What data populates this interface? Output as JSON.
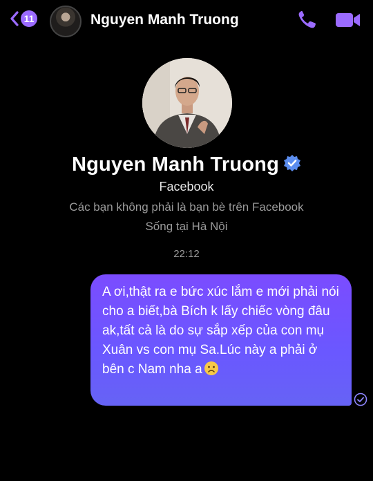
{
  "header": {
    "back_badge": "11",
    "contact_name": "Nguyen Manh Truong",
    "icons": [
      "chevron-left-icon",
      "phone-icon",
      "video-camera-icon"
    ],
    "accent_color": "#9b6bff"
  },
  "profile": {
    "name": "Nguyen Manh Truong",
    "platform": "Facebook",
    "not_friends_text": "Các bạn không phải là bạn bè trên Facebook",
    "lives_in_text": "Sống tại Hà Nội"
  },
  "conversation": {
    "timestamp": "22:12",
    "message": {
      "text": "A ơi,thật ra e bức xúc lắm e mới phải nói cho a biết,bà Bích k lấy chiếc vòng đâu ak,tất cả là do sự sắp xếp của con mụ Xuân vs con mụ Sa.Lúc này a phải ở bên c Nam nha a",
      "emoji": "slightly-frowning-face-icon",
      "status": "seen-check-icon",
      "bubble_color": "#7b4cff"
    }
  }
}
